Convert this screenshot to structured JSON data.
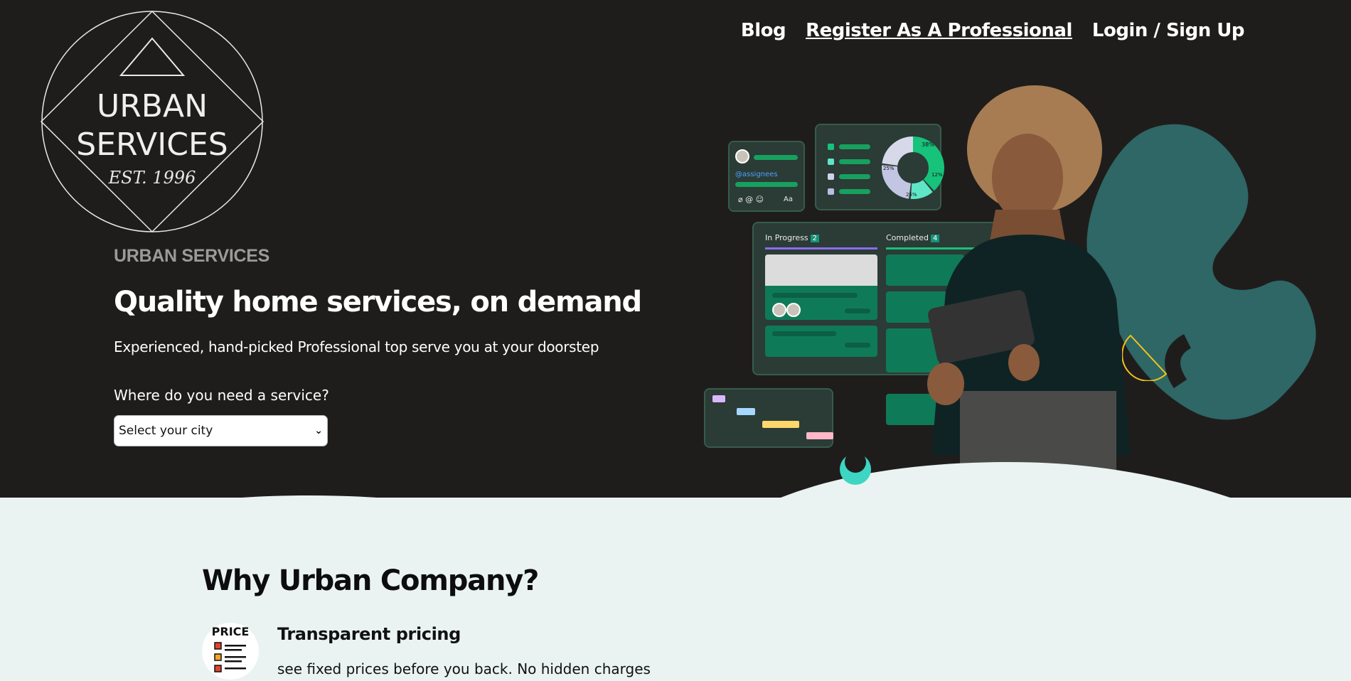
{
  "nav": {
    "blog": "Blog",
    "register": "Register As A Professional",
    "login": "Login / Sign Up"
  },
  "logo": {
    "line1": "URBAN",
    "line2": "SERVICES",
    "line3": "EST. 1996"
  },
  "hero": {
    "brand": "URBAN SERVICES",
    "title": "Quality home services, on demand",
    "description": "Experienced, hand-picked Professional top serve you at your doorstep",
    "city_label": "Where do you need a service?",
    "city_select_value": "Select your city"
  },
  "illustration": {
    "assignees_tag": "@assignees",
    "text_tool": "Aa",
    "in_progress_label": "In Progress",
    "in_progress_count": "2",
    "completed_label": "Completed",
    "completed_count": "4",
    "pie_38": "38%",
    "pie_25a": "25%",
    "pie_12": "12%",
    "pie_25b": "25%"
  },
  "why": {
    "title": "Why Urban Company?",
    "feature_icon_text": "PRICE",
    "feature_title": "Transparent pricing",
    "feature_desc": "see fixed prices before you back. No hidden charges"
  },
  "colors": {
    "hero_bg": "#1f1d1c",
    "section_bg": "#eaf3f2",
    "accent_green": "#0fbd6e",
    "teal": "#2f6b6a"
  }
}
